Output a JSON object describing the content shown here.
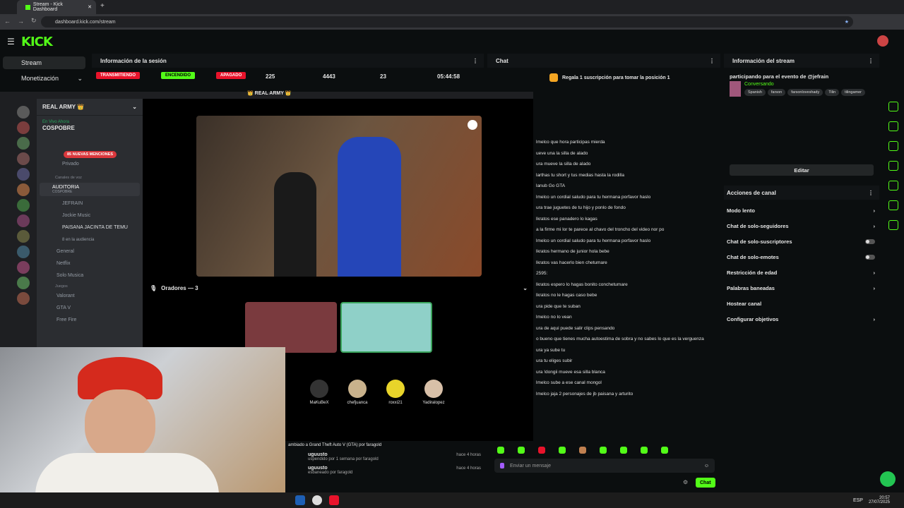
{
  "browser": {
    "tab_title": "Stream - Kick Dashboard",
    "url": "dashboard.kick.com/stream"
  },
  "app": {
    "logo": "KICK"
  },
  "nav": {
    "stream": "Stream",
    "monetization": "Monetización"
  },
  "session": {
    "title": "Información de la sesión",
    "status_chips": [
      "TRANSMITIENDO",
      "ENCENDIDO",
      "APAGADO"
    ],
    "stats": [
      "225",
      "4443",
      "23",
      "05:44:58"
    ]
  },
  "chat": {
    "title": "Chat",
    "promo": "Regala 1 suscripción para tomar la posición 1",
    "input_placeholder": "Enviar un mensaje",
    "send_label": "Chat",
    "messages": [
      "lmelco que hora participas mierda",
      "ueve una la silla de alado",
      "ura mueve la silla de alado",
      "larthas tu short y tus medias hasta la rodilla",
      "lanub Go GTA",
      "lmelco un cordial saludo para tu hermana porfavor haslo",
      "ura trae juguetes de tu hijo y ponlo de fondo",
      "lkratos ese panadero lo kagas",
      "a la firme mi lor te parece al chavo del troncho del video nor po",
      "lmelco un cordial saludo para tu hermana porfavor haslo",
      "lkratos hermano de junior hola bebe",
      "lkratos vas hacerlo bien chetumare",
      "2595:",
      "lkratos espero lo hagas bonito conchetumare",
      "lkratos no le hagas caso bebe",
      "ura pide que te suban",
      "lmelco no lo vean",
      "ura de aqui puede salir clips pensando",
      "o bueno que tienes mucha autoestima de sobra y no sabes lo que es la verguenza",
      "ura ya sube tu",
      "ura tu eliges subir",
      "ura !dongii mueve esa silla blanca",
      "lmelco sube a ese canal mongol",
      "lmelco jaja 2 personajes de jb paisana y arturito"
    ]
  },
  "stream_info": {
    "title": "Información del stream",
    "stream_title": "participando para el evento de @jefrain",
    "category": "Conversando",
    "tags": [
      "Spanish",
      "farson",
      "farsonloveshady",
      "Tilin",
      "tilingamer"
    ],
    "edit_label": "Editar"
  },
  "channel_actions": {
    "title": "Acciones de canal",
    "items": [
      {
        "label": "Modo lento",
        "control": "chevron"
      },
      {
        "label": "Chat de solo-seguidores",
        "control": "chevron"
      },
      {
        "label": "Chat de solo-suscriptores",
        "control": "toggle"
      },
      {
        "label": "Chat de solo-emotes",
        "control": "toggle"
      },
      {
        "label": "Restricción de edad",
        "control": "chevron"
      },
      {
        "label": "Palabras baneadas",
        "control": "chevron"
      },
      {
        "label": "Hostear canal",
        "control": "none"
      },
      {
        "label": "Configurar objetivos",
        "control": "chevron"
      }
    ]
  },
  "discord": {
    "server_name": "REAL ARMY 👑",
    "window_title": "👑 REAL ARMY 👑",
    "live_now": "En Vivo Ahora",
    "live_channel": "COSPOBRE",
    "mentions": "85 NUEVAS MENCIONES",
    "private": "Privado",
    "voice_header": "Canales de voz",
    "auditoria": "AUDITORIA",
    "auditoria_sub": "COSPOBRE",
    "users_in_voice": [
      "JEFRAIN",
      "Jockie Music",
      "PAISANA JACINTA DE TEMU"
    ],
    "audience": "8 en la audiencia",
    "channels": [
      "General",
      "Netflix",
      "Solo Musica"
    ],
    "games_header": "Juegos",
    "game_channels": [
      "Valorant",
      "GTA V",
      "Free Fire"
    ],
    "speakers": "Oradores — 3",
    "listeners": [
      "MaKuBeX",
      "chefjuanca",
      "roxxi21",
      "Yadiralopez"
    ]
  },
  "activity": [
    {
      "text": "ambiado a Grand Theft Auto V (GTA) por faragold",
      "time": ""
    },
    {
      "user": "uguusto",
      "text": "uspendido por 1 semana por faragold",
      "time": "hace 4 horas"
    },
    {
      "user": "uguusto",
      "text": "esbaneado por faragold",
      "time": "hace 4 horas"
    }
  ],
  "taskbar": {
    "lang": "ESP",
    "time": "20:57",
    "date": "27/07/2025"
  }
}
